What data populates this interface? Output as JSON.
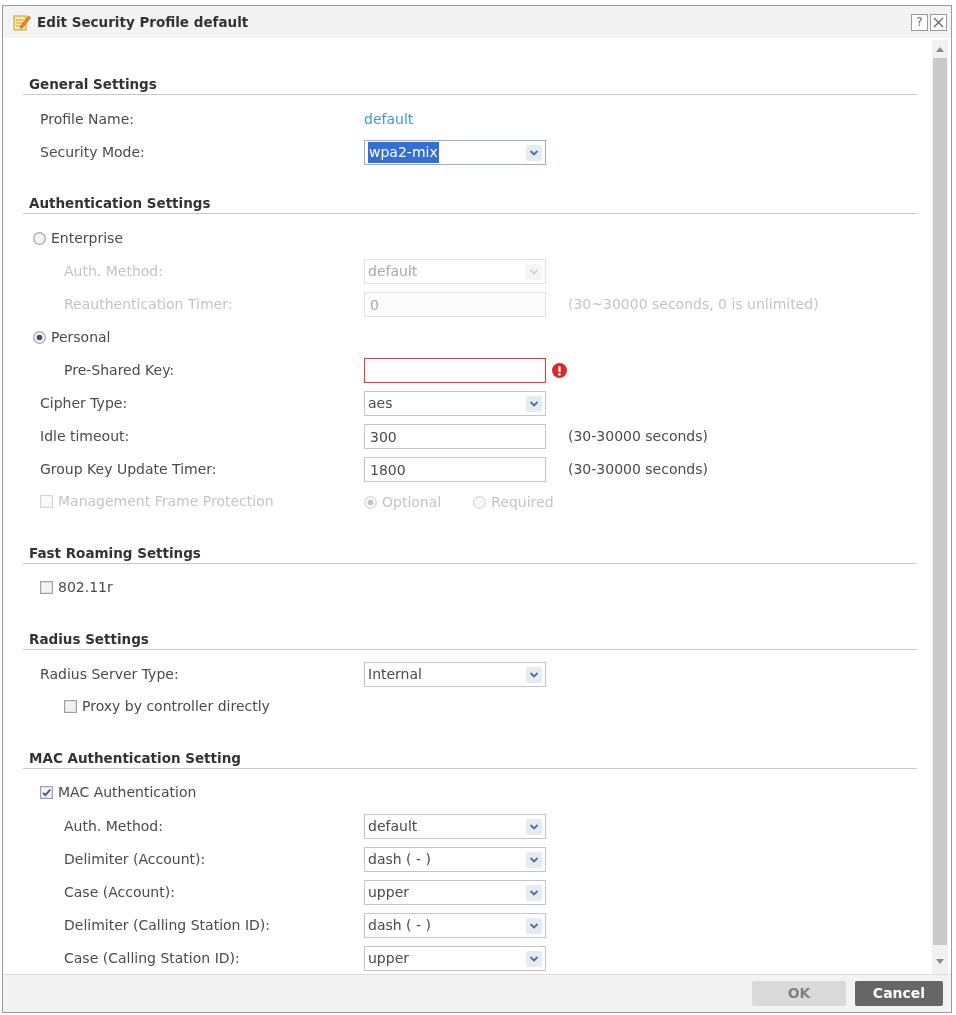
{
  "window": {
    "title": "Edit Security Profile default",
    "help_label": "?"
  },
  "sections": [
    {
      "title": "General Settings",
      "rows": [
        {
          "kind": "text",
          "label": "Profile Name:",
          "value": "default",
          "disabled": false
        },
        {
          "kind": "select",
          "label": "Security Mode:",
          "value": "wpa2-mix",
          "focused": true,
          "disabled": false
        }
      ]
    },
    {
      "title": "Authentication Settings",
      "rows": [
        {
          "kind": "radio",
          "label": "Enterprise",
          "selected": false,
          "disabled": false,
          "children": [
            {
              "kind": "select",
              "label": "Auth. Method:",
              "value": "default",
              "focused": false,
              "disabled": true
            },
            {
              "kind": "input",
              "label": "Reauthentication Timer:",
              "value": "0",
              "hint": "(30~30000 seconds, 0 is unlimited)",
              "invalid": false,
              "disabled": true
            }
          ]
        },
        {
          "kind": "radio",
          "label": "Personal",
          "selected": true,
          "disabled": false,
          "children": [
            {
              "kind": "input",
              "label": "Pre-Shared Key:",
              "invalid": true,
              "disabled": false
            }
          ]
        },
        {
          "kind": "select",
          "label": "Cipher Type:",
          "value": "aes",
          "focused": false,
          "disabled": false
        },
        {
          "kind": "input",
          "label": "Idle timeout:",
          "value": "300",
          "hint": "(30-30000 seconds)",
          "invalid": false,
          "disabled": false
        },
        {
          "kind": "input",
          "label": "Group Key Update Timer:",
          "value": "1800",
          "hint": "(30-30000 seconds)",
          "invalid": false,
          "disabled": false
        },
        {
          "kind": "checkbox",
          "label": "Management Frame Protection",
          "checked": false,
          "disabled": true,
          "options": [
            {
              "label": "Optional",
              "selected": true
            },
            {
              "label": "Required",
              "selected": false
            }
          ]
        }
      ]
    },
    {
      "title": "Fast Roaming Settings",
      "rows": [
        {
          "kind": "checkbox",
          "label": "802.11r",
          "checked": false,
          "disabled": false
        }
      ]
    },
    {
      "title": "Radius Settings",
      "rows": [
        {
          "kind": "select",
          "label": "Radius Server Type:",
          "value": "Internal",
          "focused": false,
          "disabled": false,
          "children": [
            {
              "kind": "checkbox",
              "label": "Proxy by controller directly",
              "checked": false,
              "disabled": false
            }
          ]
        }
      ]
    },
    {
      "title": "MAC Authentication Setting",
      "rows": [
        {
          "kind": "checkbox",
          "label": "MAC Authentication",
          "checked": true,
          "disabled": false,
          "children": [
            {
              "kind": "select",
              "label": "Auth. Method:",
              "value": "default",
              "focused": false,
              "disabled": false
            },
            {
              "kind": "select",
              "label": "Delimiter (Account):",
              "value": "dash ( - )",
              "focused": false,
              "disabled": false
            },
            {
              "kind": "select",
              "label": "Case (Account):",
              "value": "upper",
              "focused": false,
              "disabled": false
            },
            {
              "kind": "select",
              "label": "Delimiter (Calling Station ID):",
              "value": "dash ( - )",
              "focused": false,
              "disabled": false
            },
            {
              "kind": "select",
              "label": "Case (Calling Station ID):",
              "value": "upper",
              "focused": false,
              "disabled": false
            }
          ]
        }
      ]
    }
  ],
  "buttons": [
    {
      "label": "OK",
      "disabled": true
    },
    {
      "label": "Cancel",
      "disabled": false
    }
  ]
}
